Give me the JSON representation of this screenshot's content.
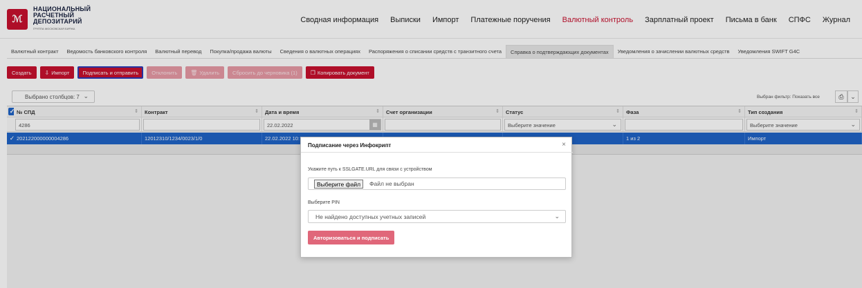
{
  "header": {
    "logo_mark": "ℳ",
    "logo_lines": [
      "НАЦИОНАЛЬНЫЙ",
      "РАСЧЕТНЫЙ",
      "ДЕПОЗИТАРИЙ"
    ],
    "logo_sub": "ГРУППА МОСКОВСКАЯ БИРЖА",
    "nav": [
      "Сводная информация",
      "Выписки",
      "Импорт",
      "Платежные поручения",
      "Валютный контроль",
      "Зарплатный проект",
      "Письма в банк",
      "СПФС",
      "Журнал"
    ],
    "active_index": 4
  },
  "subnav": {
    "tabs": [
      "Валютный контракт",
      "Ведомость банковского контроля",
      "Валютный перевод",
      "Покупка/продажа валюты",
      "Сведения о валютных операциях",
      "Распоряжения о списании средств с транзитного счета",
      "Справка о подтверждающих документах",
      "Уведомления о зачислении валютных средств",
      "Уведомления SWIFT G4C"
    ],
    "active_index": 6
  },
  "toolbar": {
    "create": "Создать",
    "import": "Импорт",
    "sign_send": "Подписать и отправить",
    "reject": "Отклонить",
    "delete": "Удалить",
    "reset_draft": "Сбросить до черновика (1)",
    "copy": "Копировать документ"
  },
  "grid": {
    "columns_selected": "Выбрано столбцов: 7",
    "filter_label": "Выбран фильтр: Показать все",
    "headers": [
      "№ СПД",
      "Контракт",
      "Дата и время",
      "Счет организации",
      "Статус",
      "Фаза",
      "Тип создания"
    ],
    "filters": {
      "num": "4286",
      "contract": "",
      "date": "22.02.2022",
      "account": "",
      "status_placeholder": "Выберите значение",
      "phase": "",
      "type_placeholder": "Выберите значение"
    },
    "rows": [
      {
        "num": "202122000000004286",
        "contract": "12012310/1234/0023/1/0",
        "date": "22.02.2022 10:",
        "account": "",
        "status": "",
        "phase": "1 из 2",
        "type": "Импорт"
      }
    ]
  },
  "modal": {
    "title": "Подписание через Инфокрипт",
    "path_label": "Укажите путь к SSLGATE.URL для связи с устройством",
    "file_button": "Выберите файл",
    "file_none": "Файл не выбран",
    "pin_label": "Выберите PIN",
    "pin_value": "Не найдено доступных учетных записей",
    "submit": "Авторизоваться и подписать"
  },
  "colors": {
    "brand": "#c8102e",
    "selected_row": "#1f63c6"
  }
}
